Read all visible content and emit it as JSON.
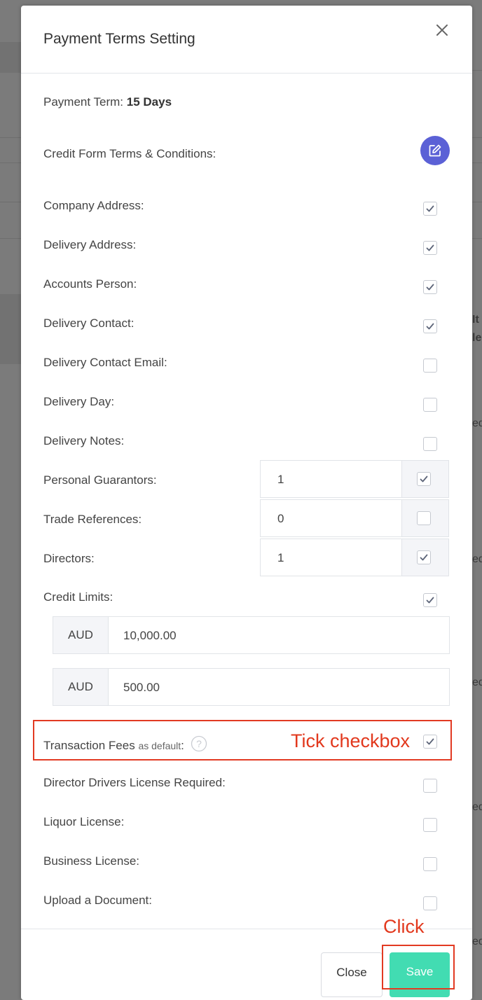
{
  "modal": {
    "title": "Payment Terms Setting",
    "payment_term_label": "Payment Term:",
    "payment_term_value": "15 Days",
    "credit_form_label": "Credit Form Terms & Conditions:",
    "rows": [
      {
        "label": "Company Address:",
        "checked": true
      },
      {
        "label": "Delivery Address:",
        "checked": true
      },
      {
        "label": "Accounts Person:",
        "checked": true
      },
      {
        "label": "Delivery Contact:",
        "checked": true
      },
      {
        "label": "Delivery Contact Email:",
        "checked": false
      },
      {
        "label": "Delivery Day:",
        "checked": false
      },
      {
        "label": "Delivery Notes:",
        "checked": false
      }
    ],
    "numeric_rows": [
      {
        "label": "Personal Guarantors:",
        "value": "1",
        "checked": true
      },
      {
        "label": "Trade References:",
        "value": "0",
        "checked": false
      },
      {
        "label": "Directors:",
        "value": "1",
        "checked": true
      }
    ],
    "credit_limits": {
      "label": "Credit Limits:",
      "checked": true,
      "limits": [
        {
          "currency": "AUD",
          "amount": "10,000.00"
        },
        {
          "currency": "AUD",
          "amount": "500.00"
        }
      ]
    },
    "transaction_fees": {
      "label": "Transaction Fees",
      "suffix": "as default",
      "colon": ":",
      "checked": true
    },
    "rows_bottom": [
      {
        "label": "Director Drivers License Required:",
        "checked": false
      },
      {
        "label": "Liquor License:",
        "checked": false
      },
      {
        "label": "Business License:",
        "checked": false
      },
      {
        "label": "Upload a Document:",
        "checked": false
      }
    ],
    "buttons": {
      "close": "Close",
      "save": "Save"
    }
  },
  "annotations": {
    "tick": "Tick checkbox",
    "click": "Click"
  },
  "background": {
    "fragments": [
      "It",
      "le",
      "ed",
      "ed",
      "ed",
      "ed",
      "ed"
    ]
  },
  "colors": {
    "accent": "#5b61d6",
    "save": "#42dcb2",
    "annotation": "#e2381d"
  },
  "icons": {
    "close": "close-icon",
    "edit": "edit-icon",
    "help": "help-icon",
    "check": "check-icon"
  }
}
